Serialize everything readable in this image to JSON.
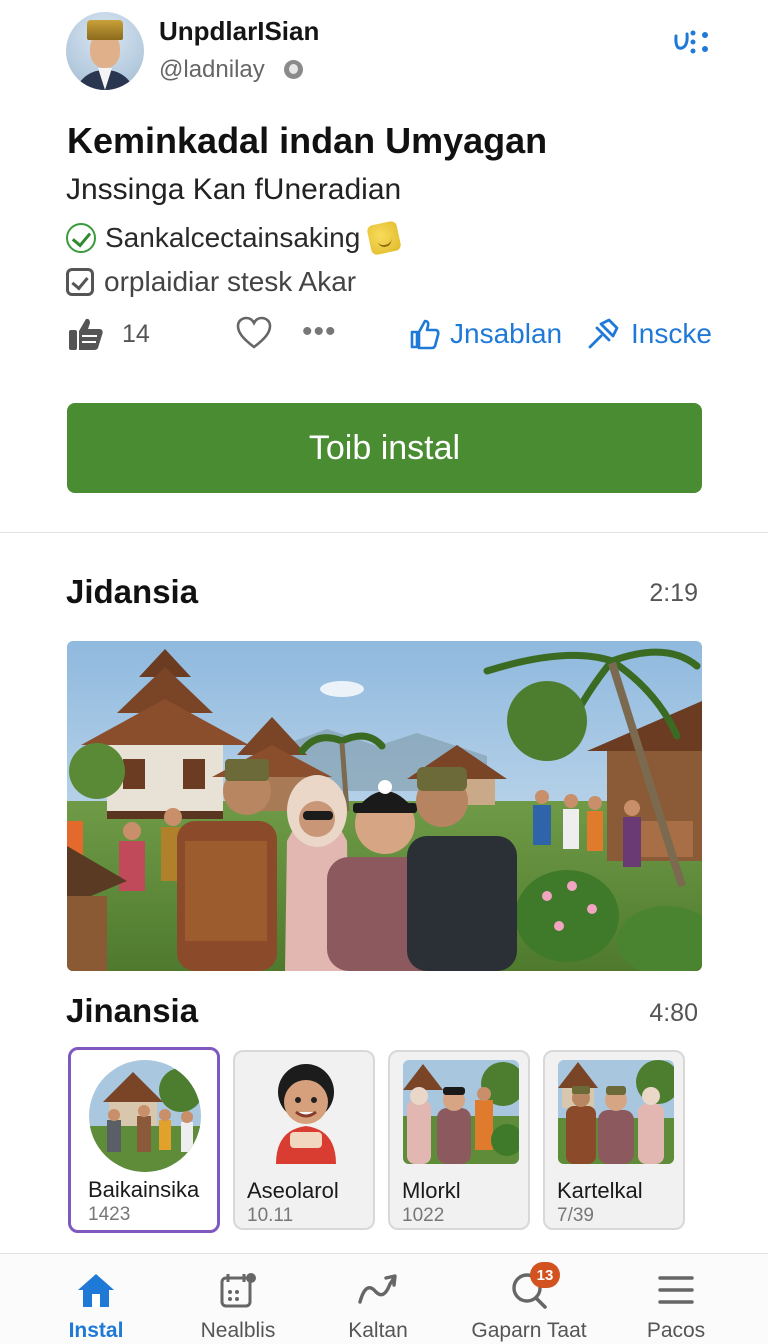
{
  "profile": {
    "name": "UnpdlarISian",
    "handle": "@ladnilay"
  },
  "post": {
    "title": "Keminkadal indan Umyagan",
    "subtitle": "Jnssinga Kan fUneradian",
    "feature_1": "Sankalcectainsaking",
    "feature_2": "orplaidiar stesk Akar"
  },
  "actions": {
    "like_count": "14",
    "share_label": "Jnsablan",
    "invite_label": "Inscke"
  },
  "primary_button": {
    "label": "Toib instal"
  },
  "section_1": {
    "title": "Jidansia",
    "time": "2:19"
  },
  "section_2": {
    "title": "Jinansia",
    "time": "4:80"
  },
  "thumbnails": [
    {
      "name": "Baikainsika",
      "count": "1423"
    },
    {
      "name": "Aseolarol",
      "count": "10.11"
    },
    {
      "name": "Mlorkl",
      "count": "1022"
    },
    {
      "name": "Kartelkal",
      "count": "7/39"
    }
  ],
  "tabs": [
    {
      "label": "Instal",
      "icon": "home-icon"
    },
    {
      "label": "Nealblis",
      "icon": "calendar-icon"
    },
    {
      "label": "Kaltan",
      "icon": "wave-icon"
    },
    {
      "label": "Gaparn Taat",
      "icon": "search-icon"
    },
    {
      "label": "Pacos",
      "icon": "menu-lines-icon"
    }
  ],
  "badge_count": "13",
  "colors": {
    "accent_blue": "#1f79d6",
    "primary_green": "#4a8c32",
    "selected_purple": "#7f58c0",
    "badge_orange": "#d2531f"
  }
}
